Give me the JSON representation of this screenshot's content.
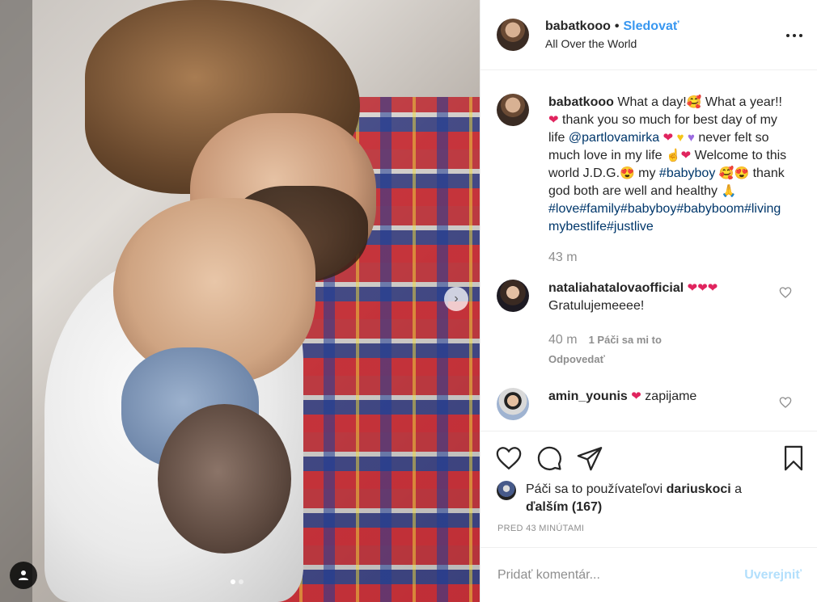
{
  "post": {
    "username": "babatkooo",
    "separator": "•",
    "follow_label": "Sledovať",
    "location": "All Over the World",
    "caption": {
      "text1": "What a day!",
      "text2": " What a year!!",
      "text3": " thank you so much for best day of my life ",
      "mention": "@partlovamirka",
      "text4": " never felt so much love in my life ",
      "text5": " Welcome to this world J.D.G.",
      "text6": " my ",
      "hashtag_babyboy": "#babyboy",
      "text7": " thank god both are well and healthy ",
      "hashtags": "#love#family#babyboy#babyboom#livingmybestlife#justlive"
    },
    "caption_time": "43 m"
  },
  "comments": [
    {
      "username": "nataliahatalovaofficial",
      "text": "Gratulujemeeee!",
      "time": "40 m",
      "likes_label": "1 Páči sa mi to",
      "reply_label": "Odpovedať"
    },
    {
      "username": "amin_younis",
      "text": "zapijame"
    }
  ],
  "likes": {
    "prefix": "Páči sa to používateľovi ",
    "liker": "dariuskoci",
    "suffix": " a",
    "others": "ďalším (167)"
  },
  "timestamp": "Pred 43 minútami",
  "add_comment": {
    "placeholder": "Pridať komentár...",
    "post_label": "Uverejniť"
  },
  "icons": {
    "heart": "heart-icon",
    "comment": "comment-icon",
    "share": "share-icon",
    "save": "bookmark-icon"
  },
  "colors": {
    "accent": "#3897f0",
    "link": "#00376b",
    "muted": "#8e8e8e",
    "post_disabled": "#b2dffc"
  },
  "carousel": {
    "total": 2,
    "active": 1
  }
}
